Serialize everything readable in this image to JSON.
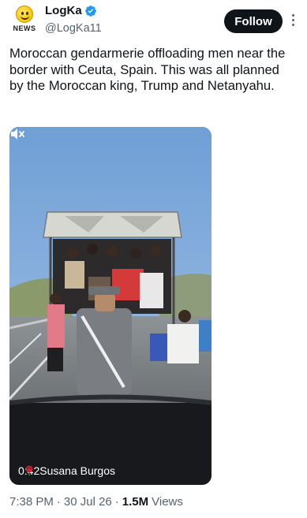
{
  "author": {
    "display_name": "LogKa",
    "handle": "@LogKa11",
    "avatar_badge_text": "NEWS",
    "verified": true
  },
  "actions": {
    "follow_label": "Follow"
  },
  "tweet": {
    "text": "Moroccan gendarmerie offloading men near the border with Ceuta, Spain. This was all planned by the Moroccan king, Trump and Netanyahu."
  },
  "video": {
    "elapsed": "0:42",
    "credit": "Susana Burgos",
    "muted": true
  },
  "meta": {
    "time": "7:38 PM",
    "date": "30 Jul 26",
    "views_count": "1.5M",
    "views_label": "Views",
    "separator": "·"
  },
  "colors": {
    "text_primary": "#0f1419",
    "text_secondary": "#536471",
    "verified_blue": "#1d9bf0",
    "follow_bg": "#0f1419"
  }
}
